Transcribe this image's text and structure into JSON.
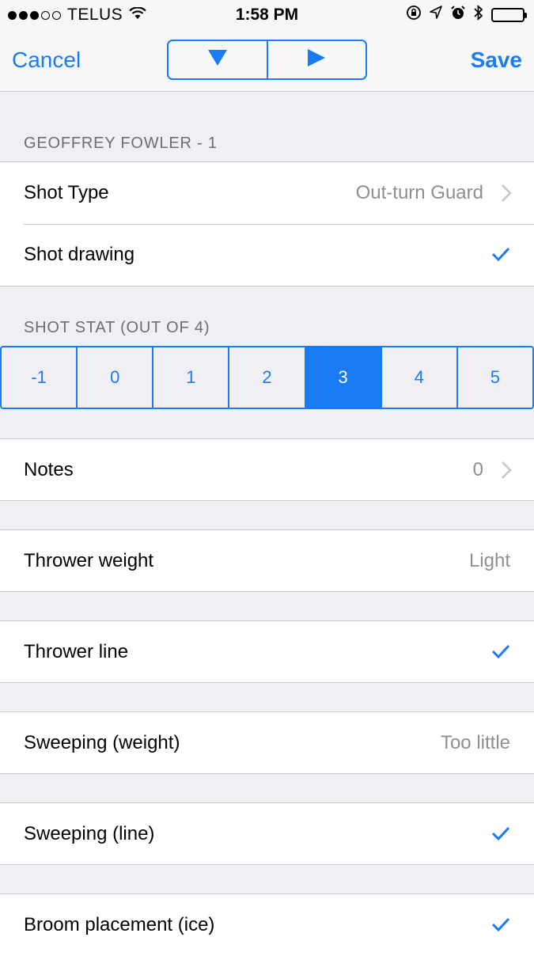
{
  "status_bar": {
    "carrier": "TELUS",
    "time": "1:58 PM",
    "signal_bars_filled": 3,
    "signal_bars_total": 5
  },
  "nav": {
    "cancel_label": "Cancel",
    "save_label": "Save",
    "down_icon": "triangle-down-icon",
    "play_icon": "triangle-right-icon"
  },
  "accent_color": "#1a7cf4",
  "player_section": {
    "header": "GEOFFREY FOWLER - 1",
    "rows": [
      {
        "label": "Shot Type",
        "value": "Out-turn Guard",
        "accessory": "chevron"
      },
      {
        "label": "Shot drawing",
        "accessory": "checkmark"
      }
    ]
  },
  "shot_stat": {
    "header": "SHOT STAT (OUT OF 4)",
    "options": [
      "-1",
      "0",
      "1",
      "2",
      "3",
      "4",
      "5"
    ],
    "selected": "3"
  },
  "notes": {
    "label": "Notes",
    "value": "0",
    "accessory": "chevron"
  },
  "thrower_weight": {
    "label": "Thrower weight",
    "value": "Light"
  },
  "thrower_line": {
    "label": "Thrower line",
    "accessory": "checkmark"
  },
  "sweeping_weight": {
    "label": "Sweeping (weight)",
    "value": "Too little"
  },
  "sweeping_line": {
    "label": "Sweeping (line)",
    "accessory": "checkmark"
  },
  "broom_placement": {
    "label": "Broom placement (ice)",
    "accessory": "checkmark"
  }
}
